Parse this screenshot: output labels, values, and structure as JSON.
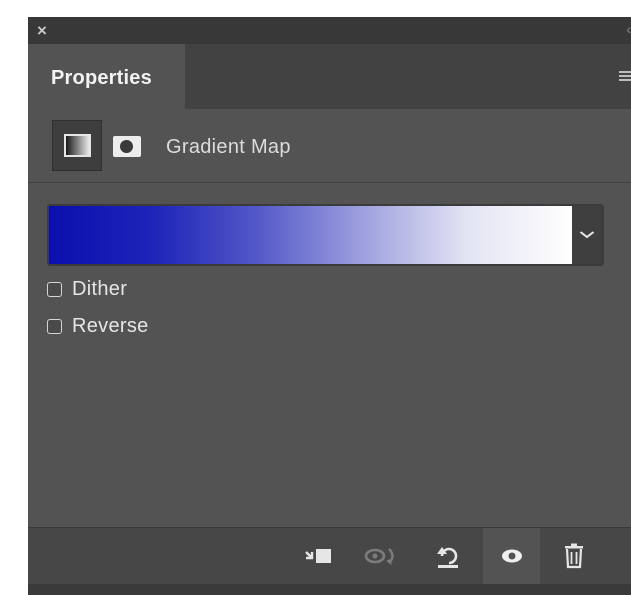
{
  "window": {
    "close_glyph": "×",
    "collapse_glyph": "‹"
  },
  "panel": {
    "tab_label": "Properties",
    "menu_icon": "panel-menu-icon"
  },
  "adjustment": {
    "title": "Gradient Map",
    "icons": [
      "gradient-map-adjustment-icon",
      "layer-mask-icon"
    ]
  },
  "gradient": {
    "colors": [
      "#0a0fae",
      "#1e24b8",
      "#5459c9",
      "#9ea0de",
      "#e3e4f4",
      "#ffffff"
    ],
    "dropdown_icon": "chevron-down-icon"
  },
  "options": {
    "dither": {
      "label": "Dither",
      "checked": false
    },
    "reverse": {
      "label": "Reverse",
      "checked": false
    }
  },
  "toolbar": {
    "buttons": [
      {
        "name": "clip-to-layer-icon",
        "active": false,
        "enabled": true
      },
      {
        "name": "view-previous-state-icon",
        "active": false,
        "enabled": false
      },
      {
        "name": "reset-adjustments-icon",
        "active": false,
        "enabled": true
      },
      {
        "name": "toggle-visibility-icon",
        "active": true,
        "enabled": true
      },
      {
        "name": "delete-layer-icon",
        "active": false,
        "enabled": true
      }
    ]
  },
  "colors": {
    "panel_bg": "#535353",
    "tab_strip_bg": "#424242",
    "title_bar_bg": "#383838",
    "text": "#e6e6e6"
  }
}
